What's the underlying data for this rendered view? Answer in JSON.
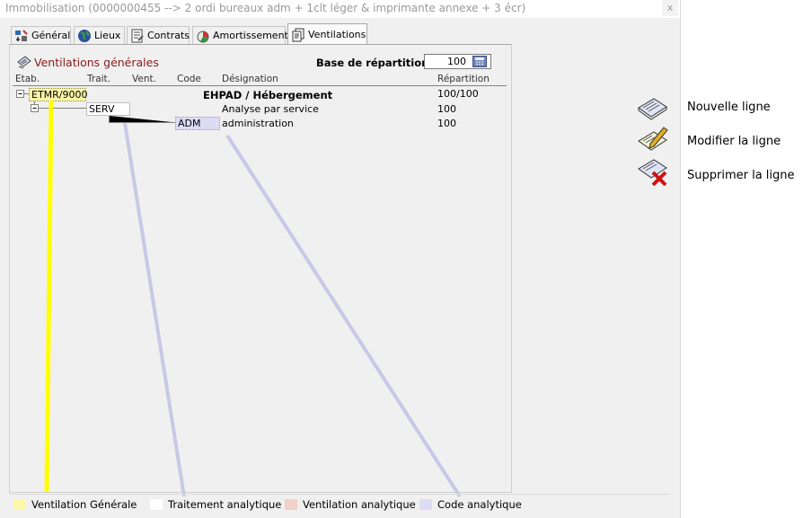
{
  "window": {
    "title": "Immobilisation (0000000455 --> 2 ordi bureaux adm + 1clt léger & imprimante annexe + 3 écr)",
    "close_label": "x"
  },
  "tabs": [
    {
      "label": "Général",
      "icon": "general-icon"
    },
    {
      "label": "Lieux",
      "icon": "globe-icon"
    },
    {
      "label": "Contrats",
      "icon": "contracts-icon"
    },
    {
      "label": "Amortissements",
      "icon": "amortization-icon"
    },
    {
      "label": "Ventilations",
      "icon": "documents-icon",
      "active": true
    }
  ],
  "section": {
    "title": "Ventilations générales",
    "base_label": "Base de répartition :",
    "base_value": "100"
  },
  "table": {
    "headers": [
      "Etab.",
      "Trait.",
      "Vent.",
      "Code",
      "Désignation",
      "Répartition"
    ],
    "rows": [
      {
        "code": "ETMR/9000",
        "designation": "EHPAD / Hébergement",
        "repartition": "100/100"
      },
      {
        "code": "SERV",
        "designation": "Analyse par service",
        "repartition": "100"
      },
      {
        "code": "ADM",
        "designation": "administration",
        "repartition": "100"
      }
    ]
  },
  "legend": [
    {
      "label": "Ventilation Générale",
      "color": "#fdf7a8"
    },
    {
      "label": "Traitement analytique",
      "color": "#ffffff"
    },
    {
      "label": "Ventilation analytique",
      "color": "#f2cfc8"
    },
    {
      "label": "Code analytique",
      "color": "#dcdcf5"
    }
  ],
  "actions": [
    {
      "label": "Nouvelle ligne",
      "icon": "new-line-icon"
    },
    {
      "label": "Modifier la ligne",
      "icon": "edit-line-icon"
    },
    {
      "label": "Supprimer la ligne",
      "icon": "delete-line-icon"
    }
  ],
  "colors": {
    "section_title": "#8b1a1a",
    "annotation_yellow": "#ffff00",
    "annotation_lavender": "#c8c8e6"
  }
}
